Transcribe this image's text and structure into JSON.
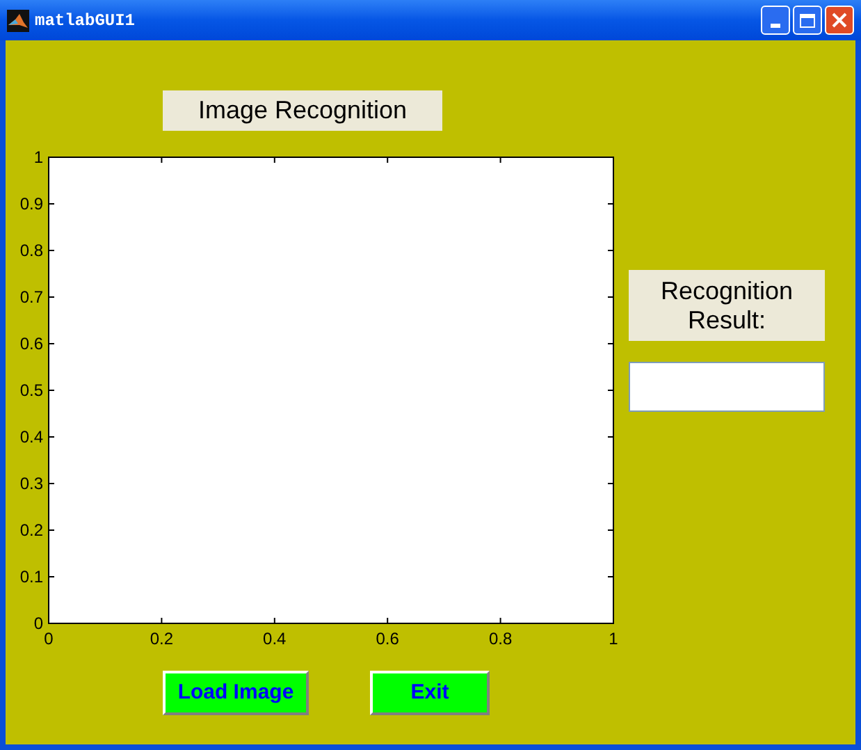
{
  "window": {
    "title": "matlabGUI1"
  },
  "heading": "Image Recognition",
  "axes": {
    "xticks": [
      "0",
      "0.2",
      "0.4",
      "0.6",
      "0.8",
      "1"
    ],
    "yticks": [
      "1",
      "0.9",
      "0.8",
      "0.7",
      "0.6",
      "0.5",
      "0.4",
      "0.3",
      "0.2",
      "0.1",
      "0"
    ]
  },
  "result_label": "Recognition Result:",
  "buttons": [
    {
      "label": "Load Image"
    },
    {
      "label": "Exit"
    }
  ]
}
